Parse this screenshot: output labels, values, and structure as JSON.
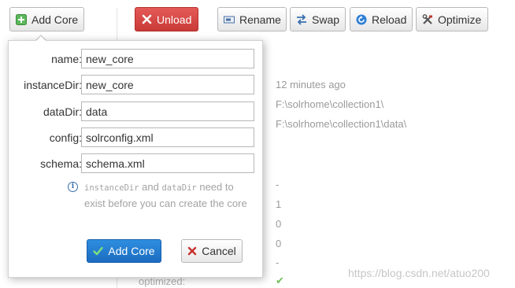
{
  "toolbar": {
    "add_core": "Add Core",
    "unload": "Unload",
    "rename": "Rename",
    "swap": "Swap",
    "reload": "Reload",
    "optimize": "Optimize"
  },
  "background": {
    "last_modified": "12 minutes ago",
    "instance_dir": "F:\\solrhome\\collection1\\",
    "data_dir": "F:\\solrhome\\collection1\\data\\",
    "values": [
      "-",
      "1",
      "0",
      "0",
      "-"
    ],
    "optimized_label": "optimized:"
  },
  "form": {
    "fields": [
      {
        "label": "name:",
        "value": "new_core"
      },
      {
        "label": "instanceDir:",
        "value": "new_core"
      },
      {
        "label": "dataDir:",
        "value": "data"
      },
      {
        "label": "config:",
        "value": "solrconfig.xml"
      },
      {
        "label": "schema:",
        "value": "schema.xml"
      }
    ],
    "hint": {
      "code1": "instanceDir",
      "and": " and ",
      "code2": "dataDir",
      "rest": " need to exist before you can create the core"
    },
    "add_button": "Add Core",
    "cancel_button": "Cancel"
  },
  "watermark": "https://blog.csdn.net/atuo200",
  "colors": {
    "unload": "#d0443f",
    "primary": "#1f75cc",
    "success": "#5cb85c",
    "danger": "#c9302c"
  }
}
